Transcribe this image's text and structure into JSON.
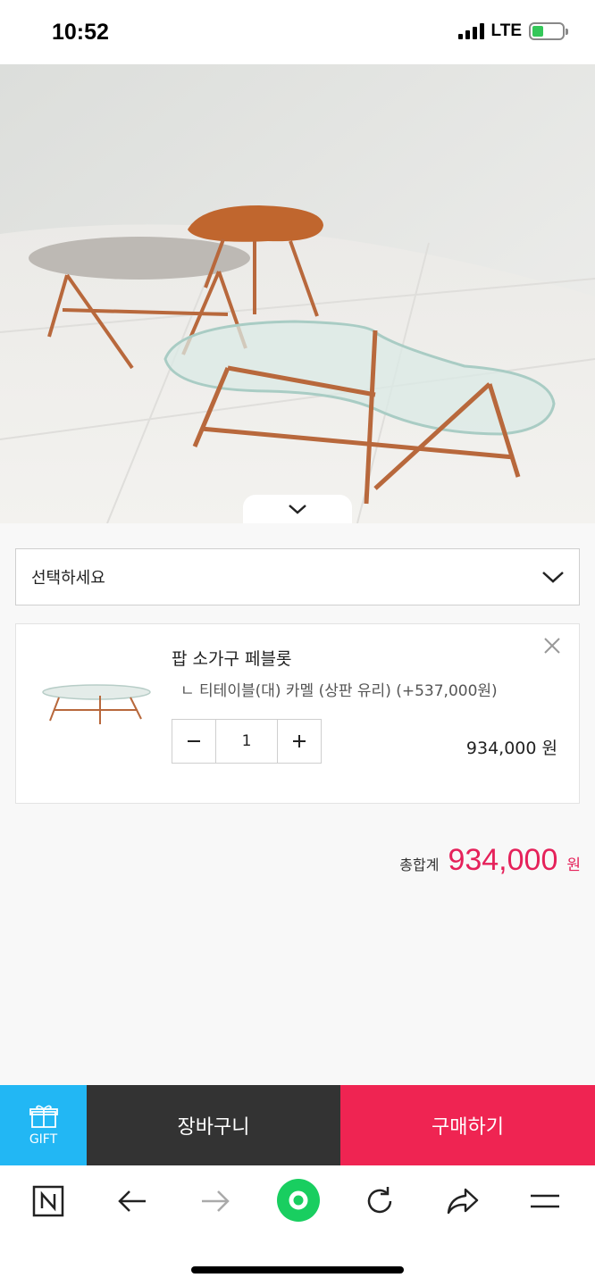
{
  "status_bar": {
    "time": "10:52",
    "network": "LTE"
  },
  "select": {
    "placeholder": "선택하세요"
  },
  "cart_item": {
    "name": "팝 소가구 페블롯",
    "option": "ㄴ 티테이블(대) 카멜 (상판 유리) (+537,000원)",
    "quantity": "1",
    "price": "934,000 원"
  },
  "total": {
    "label": "총합계",
    "amount": "934,000",
    "unit": "원"
  },
  "actions": {
    "gift_label": "GIFT",
    "cart_label": "장바구니",
    "buy_label": "구매하기"
  },
  "colors": {
    "accent": "#ef2452",
    "gift": "#22b7f4",
    "cart": "#333333",
    "price": "#e5215a"
  },
  "toolbar_icons": [
    "naver-n-icon",
    "back-arrow-icon",
    "forward-arrow-icon",
    "green-home-icon",
    "refresh-icon",
    "share-icon",
    "menu-icon"
  ]
}
